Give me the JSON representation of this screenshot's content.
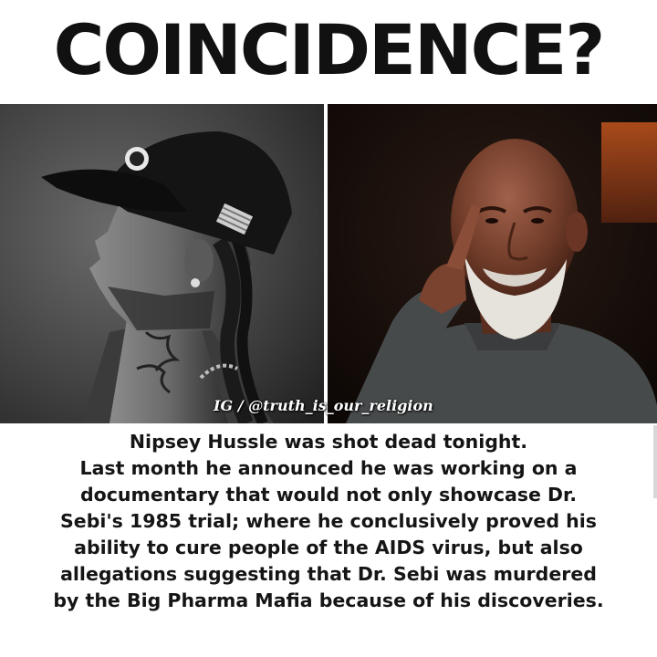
{
  "headline": "COINCIDENCE?",
  "watermark": "IG / @truth_is_our_religion",
  "caption_lines": [
    "Nipsey Hussle was shot dead tonight.",
    "Last month he announced he was working on a",
    "documentary that would not only showcase Dr.",
    "Sebi's 1985 trial; where he conclusively proved his",
    "ability to cure people of the AIDS virus, but also",
    "allegations suggesting that Dr. Sebi was murdered",
    "by the Big Pharma Mafia because of his discoveries."
  ],
  "images": {
    "left": "photo-nipsey-hussle-profile",
    "right": "photo-dr-sebi"
  },
  "colors": {
    "background": "#ffffff",
    "text": "#111111"
  }
}
